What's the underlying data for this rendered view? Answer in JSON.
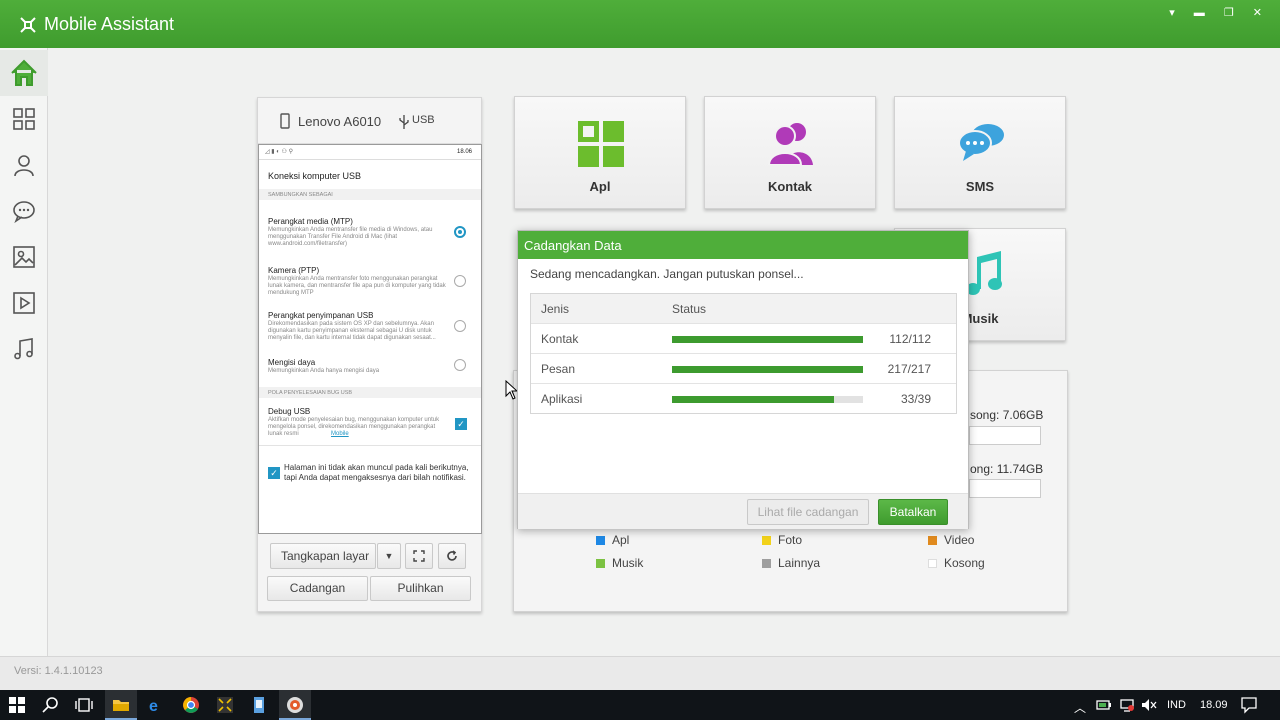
{
  "app": {
    "title": "Mobile Assistant",
    "window_controls": "▾ ▬ ❐ ✕",
    "version_label": "Versi: 1.4.1.10123"
  },
  "sidebar": {
    "items": [
      "home-icon",
      "apps-icon",
      "contacts-icon",
      "messages-icon",
      "photos-icon",
      "video-icon",
      "music-icon"
    ]
  },
  "device": {
    "name": "Lenovo A6010",
    "connection": "USB",
    "screen": {
      "time": "18.06",
      "header": "Koneksi komputer USB",
      "section1": "SAMBUNGKAN SEBAGAI",
      "options": [
        {
          "title": "Perangkat media (MTP)",
          "desc": "Memungkinkan Anda mentransfer file media di Windows, atau menggunakan Transfer File Android di Mac (lihat www.android.com/filetransfer)",
          "selected": true
        },
        {
          "title": "Kamera (PTP)",
          "desc": "Memungkinkan Anda mentransfer foto menggunakan perangkat lunak kamera, dan mentransfer file apa pun di komputer yang tidak mendukung MTP",
          "selected": false
        },
        {
          "title": "Perangkat penyimpanan USB",
          "desc": "Direkomendasikan pada sistem OS XP dan sebelumnya. Akan digunakan kartu penyimpanan eksternal sebagai U disk untuk menyalin file, dan kartu internal tidak dapat digunakan sesaat...",
          "selected": false
        },
        {
          "title": "Mengisi daya",
          "desc": "Memungkinkan Anda hanya mengisi daya",
          "selected": false
        }
      ],
      "section2": "POLA PENYELESAIAN BUG USB",
      "debug_title": "Debug USB",
      "debug_desc": "Aktifkan mode penyelesaian bug, menggunakan komputer untuk mengelola ponsel, direkomendasikan menggunakan perangkat lunak resmi",
      "debug_link": "Mobile",
      "note": "Halaman ini tidak akan muncul pada kali berikutnya, tapi Anda dapat mengaksesnya dari bilah notifikasi."
    },
    "buttons": {
      "screenshot": "Tangkapan layar",
      "backup": "Cadangan",
      "restore": "Pulihkan"
    }
  },
  "tiles": [
    {
      "label": "Apl",
      "icon": "apps-grid-icon"
    },
    {
      "label": "Kontak",
      "icon": "contacts-icon"
    },
    {
      "label": "SMS",
      "icon": "sms-icon"
    },
    {
      "label": "Musik",
      "icon": "music-icon"
    }
  ],
  "storage": {
    "row1_partial": "song: 7.06GB",
    "row2_partial": "ong: 11.74GB",
    "legend": [
      {
        "label": "Apl",
        "color": "#1e88e5"
      },
      {
        "label": "Foto",
        "color": "#f2d21b"
      },
      {
        "label": "Video",
        "color": "#e08a1e"
      },
      {
        "label": "Musik",
        "color": "#7cc242"
      },
      {
        "label": "Lainnya",
        "color": "#9e9e9e"
      },
      {
        "label": "Kosong",
        "color": "#ffffff"
      }
    ]
  },
  "dialog": {
    "title": "Cadangkan Data",
    "message": "Sedang mencadangkan. Jangan putuskan ponsel...",
    "col_type": "Jenis",
    "col_status": "Status",
    "rows": [
      {
        "type": "Kontak",
        "progress": 1.0,
        "count": "112/112"
      },
      {
        "type": "Pesan",
        "progress": 1.0,
        "count": "217/217"
      },
      {
        "type": "Aplikasi",
        "progress": 0.846,
        "count": "33/39"
      }
    ],
    "view_button": "Lihat file cadangan",
    "cancel_button": "Batalkan"
  },
  "taskbar": {
    "language": "IND",
    "time": "18.09",
    "apps": [
      "start-icon",
      "search-icon",
      "task-view-icon",
      "file-explorer-icon",
      "edge-icon",
      "chrome-icon",
      "mobile-assistant-icon",
      "app-icon",
      "browser-icon"
    ]
  }
}
